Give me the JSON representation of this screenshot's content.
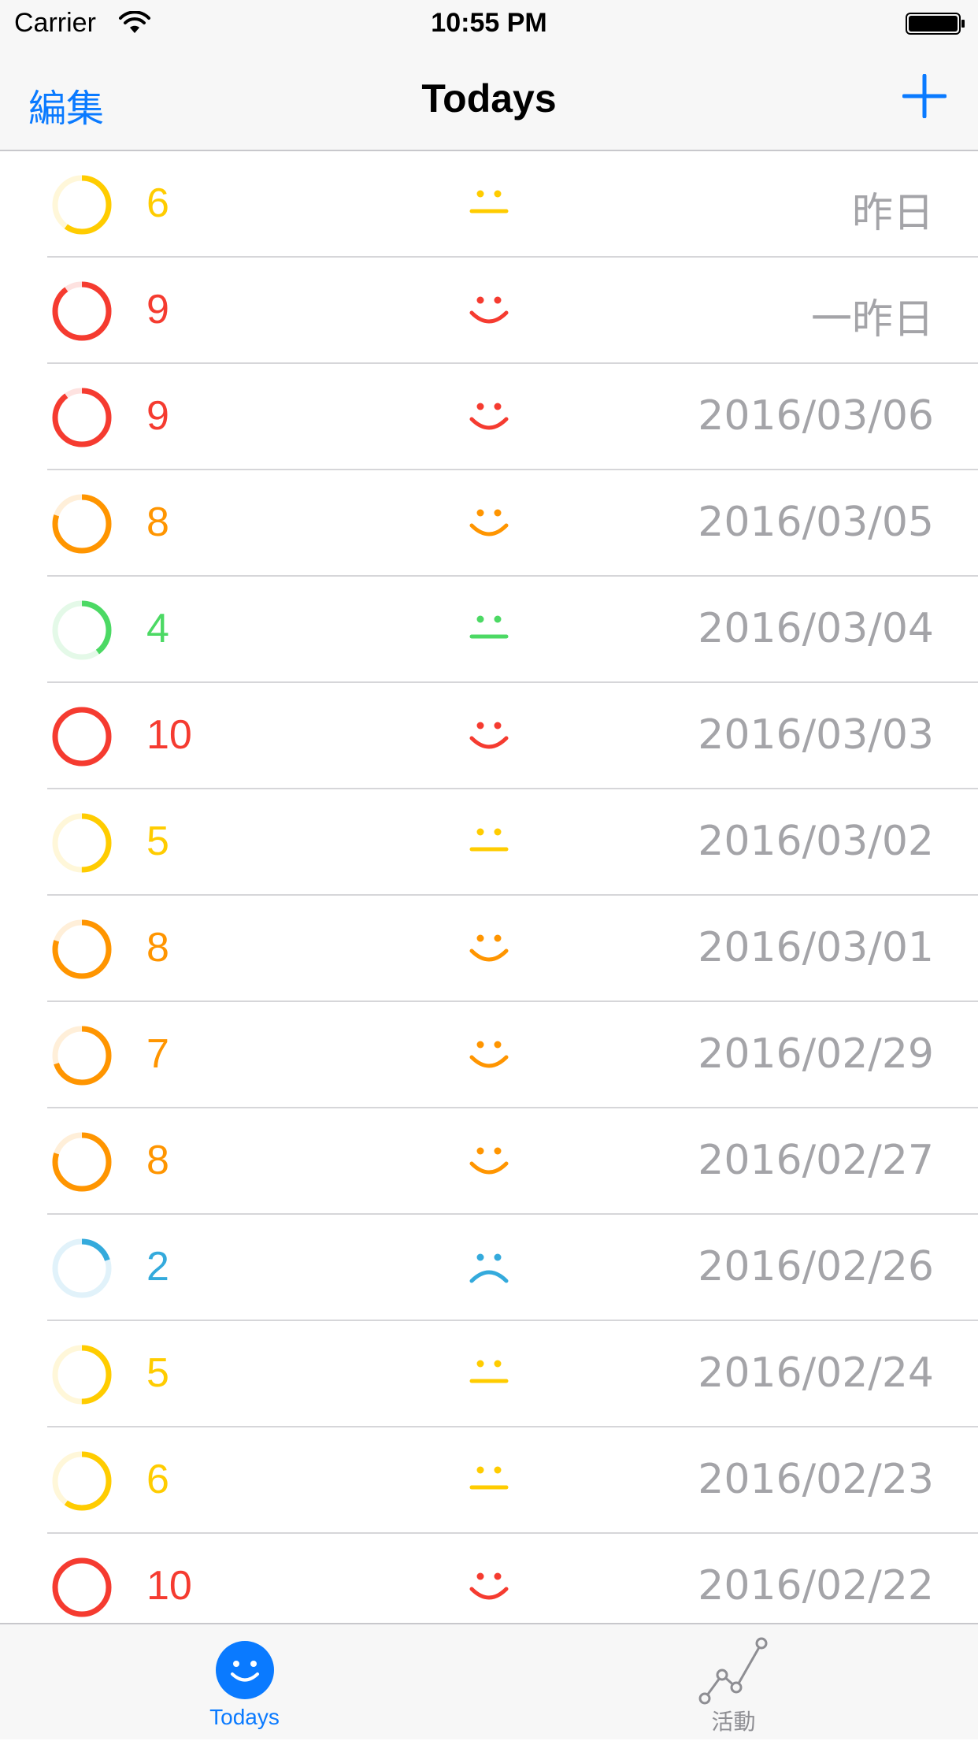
{
  "status_bar": {
    "carrier": "Carrier",
    "time": "10:55 PM"
  },
  "nav": {
    "edit_label": "編集",
    "title": "Todays",
    "add_icon": "plus-icon"
  },
  "colors": {
    "accent": "#0a7aff",
    "red": "#f53b30",
    "orange": "#ff9500",
    "yellow": "#ffcc00",
    "green": "#4cd964",
    "blue": "#34aadc",
    "date_gray": "#a4a4a8"
  },
  "entries": [
    {
      "score": "6",
      "level": 0.6,
      "mood": "neutral",
      "color": "#ffcc00",
      "date": "昨日"
    },
    {
      "score": "9",
      "level": 0.9,
      "mood": "happy",
      "color": "#f53b30",
      "date": "一昨日"
    },
    {
      "score": "9",
      "level": 0.9,
      "mood": "happy",
      "color": "#f53b30",
      "date": "2016/03/06"
    },
    {
      "score": "8",
      "level": 0.8,
      "mood": "happy",
      "color": "#ff9500",
      "date": "2016/03/05"
    },
    {
      "score": "4",
      "level": 0.4,
      "mood": "neutral",
      "color": "#4cd964",
      "date": "2016/03/04"
    },
    {
      "score": "10",
      "level": 1.0,
      "mood": "happy",
      "color": "#f53b30",
      "date": "2016/03/03"
    },
    {
      "score": "5",
      "level": 0.5,
      "mood": "neutral",
      "color": "#ffcc00",
      "date": "2016/03/02"
    },
    {
      "score": "8",
      "level": 0.8,
      "mood": "happy",
      "color": "#ff9500",
      "date": "2016/03/01"
    },
    {
      "score": "7",
      "level": 0.7,
      "mood": "happy",
      "color": "#ff9500",
      "date": "2016/02/29"
    },
    {
      "score": "8",
      "level": 0.8,
      "mood": "happy",
      "color": "#ff9500",
      "date": "2016/02/27"
    },
    {
      "score": "2",
      "level": 0.2,
      "mood": "sad",
      "color": "#34aadc",
      "date": "2016/02/26"
    },
    {
      "score": "5",
      "level": 0.5,
      "mood": "neutral",
      "color": "#ffcc00",
      "date": "2016/02/24"
    },
    {
      "score": "6",
      "level": 0.6,
      "mood": "neutral",
      "color": "#ffcc00",
      "date": "2016/02/23"
    },
    {
      "score": "10",
      "level": 1.0,
      "mood": "happy",
      "color": "#f53b30",
      "date": "2016/02/22"
    }
  ],
  "tabs": [
    {
      "label": "Todays",
      "icon": "smiley-icon",
      "selected": true
    },
    {
      "label": "活動",
      "icon": "line-chart-icon",
      "selected": false
    }
  ]
}
